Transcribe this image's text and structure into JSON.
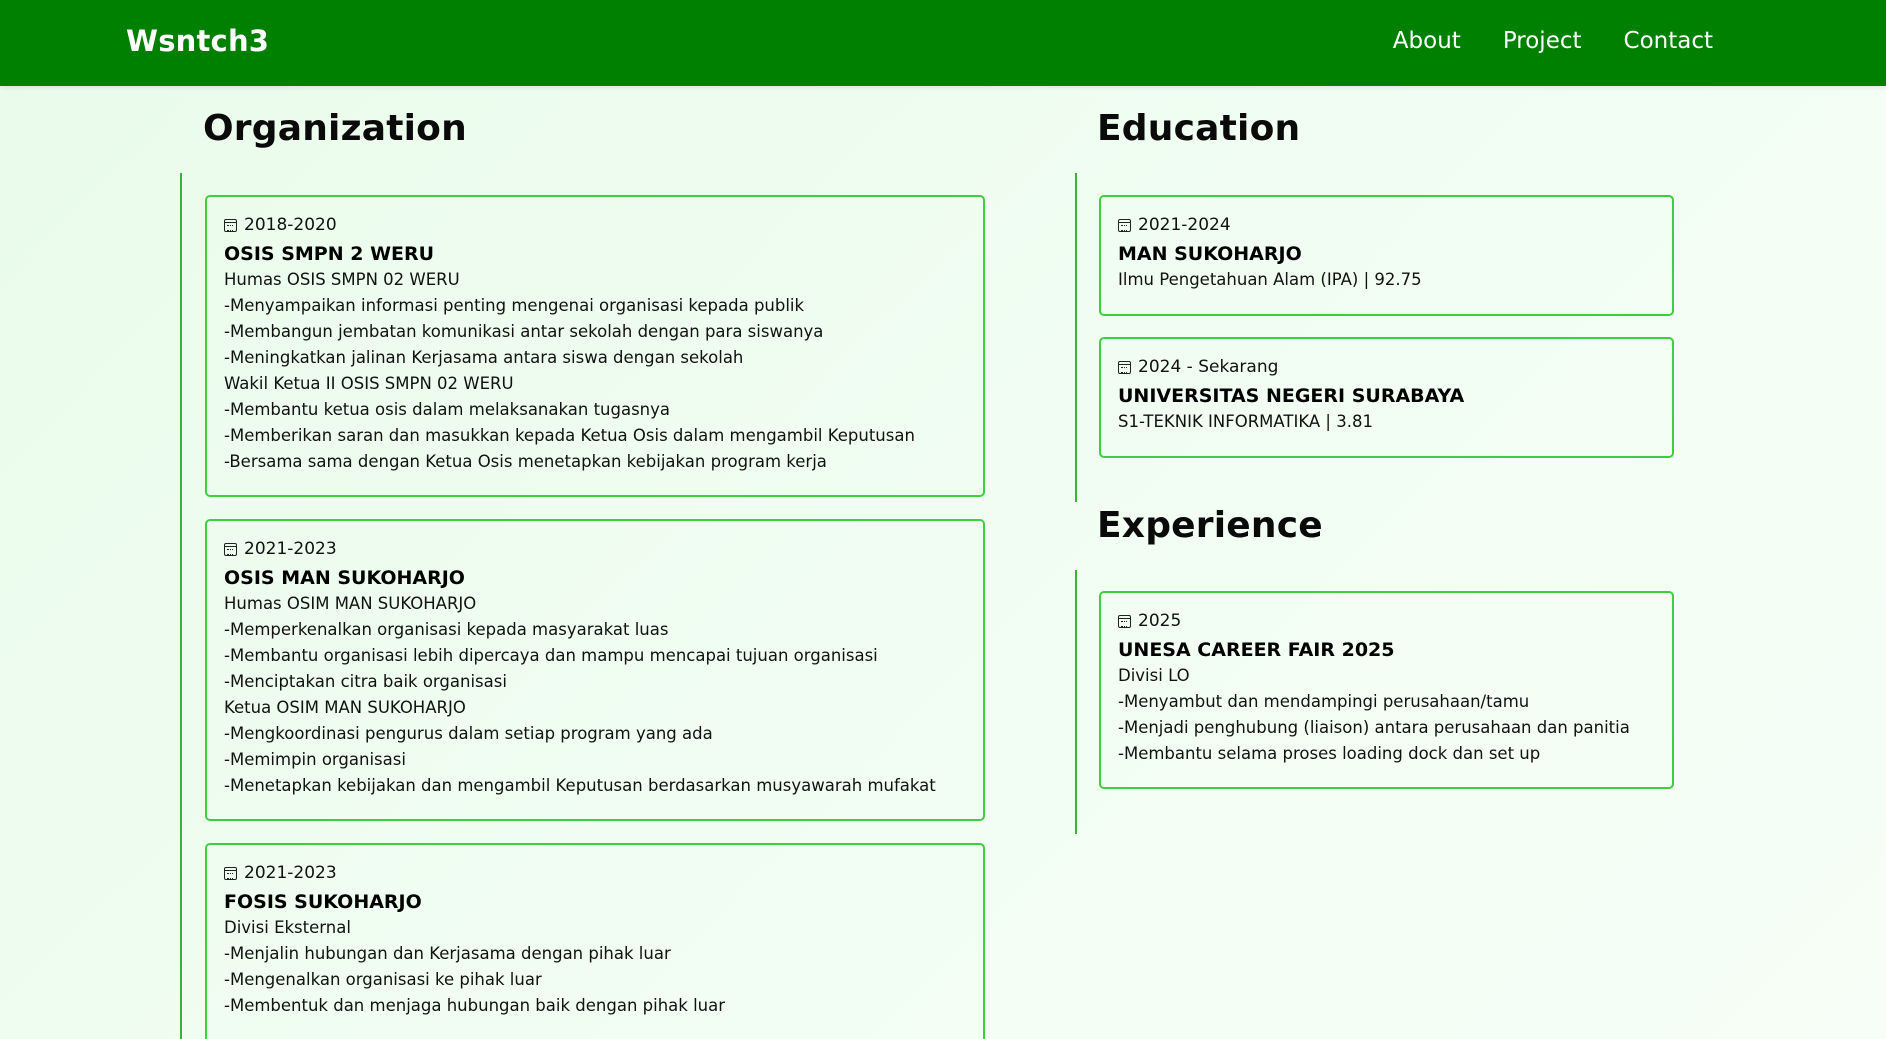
{
  "nav": {
    "brand": "Wsntch3",
    "links": [
      "About",
      "Project",
      "Contact"
    ]
  },
  "organization": {
    "title": "Organization",
    "items": [
      {
        "date": "2018-2020",
        "title": "OSIS SMPN 2 WERU",
        "lines": [
          "Humas OSIS SMPN 02 WERU",
          "-Menyampaikan informasi penting mengenai organisasi kepada publik",
          "-Membangun jembatan komunikasi antar sekolah dengan para siswanya",
          "-Meningkatkan jalinan Kerjasama antara siswa dengan sekolah",
          "Wakil Ketua II OSIS SMPN 02 WERU",
          "-Membantu ketua osis dalam melaksanakan tugasnya",
          "-Memberikan saran dan masukkan kepada Ketua Osis dalam mengambil Keputusan",
          "-Bersama sama dengan Ketua Osis menetapkan kebijakan program kerja"
        ]
      },
      {
        "date": "2021-2023",
        "title": "OSIS MAN SUKOHARJO",
        "lines": [
          "Humas OSIM MAN SUKOHARJO",
          "-Memperkenalkan organisasi kepada masyarakat luas",
          "-Membantu organisasi lebih dipercaya dan mampu mencapai tujuan organisasi",
          "-Menciptakan citra baik organisasi",
          "Ketua OSIM MAN SUKOHARJO",
          "-Mengkoordinasi pengurus dalam setiap program yang ada",
          "-Memimpin organisasi",
          "-Menetapkan kebijakan dan mengambil Keputusan berdasarkan musyawarah mufakat"
        ]
      },
      {
        "date": "2021-2023",
        "title": "FOSIS SUKOHARJO",
        "lines": [
          "Divisi Eksternal",
          "-Menjalin hubungan dan Kerjasama dengan pihak luar",
          "-Mengenalkan organisasi ke pihak luar",
          "-Membentuk dan menjaga hubungan baik dengan pihak luar"
        ]
      }
    ]
  },
  "education": {
    "title": "Education",
    "items": [
      {
        "date": "2021-2024",
        "title": "MAN SUKOHARJO",
        "lines": [
          "Ilmu Pengetahuan Alam (IPA) | 92.75"
        ]
      },
      {
        "date": "2024 - Sekarang",
        "title": "UNIVERSITAS NEGERI SURABAYA",
        "lines": [
          "S1-TEKNIK INFORMATIKA | 3.81"
        ]
      }
    ]
  },
  "experience": {
    "title": "Experience",
    "items": [
      {
        "date": "2025",
        "title": "UNESA CAREER FAIR 2025",
        "lines": [
          "Divisi LO",
          "-Menyambut dan mendampingi perusahaan/tamu",
          "-Menjadi penghubung (liaison) antara perusahaan dan panitia",
          "-Membantu selama proses loading dock dan set up"
        ]
      }
    ]
  },
  "icons": {
    "date": "calendar-icon"
  },
  "colors": {
    "nav": "#008000",
    "card_border": "#3ecf3e",
    "timeline": "#34b834"
  }
}
